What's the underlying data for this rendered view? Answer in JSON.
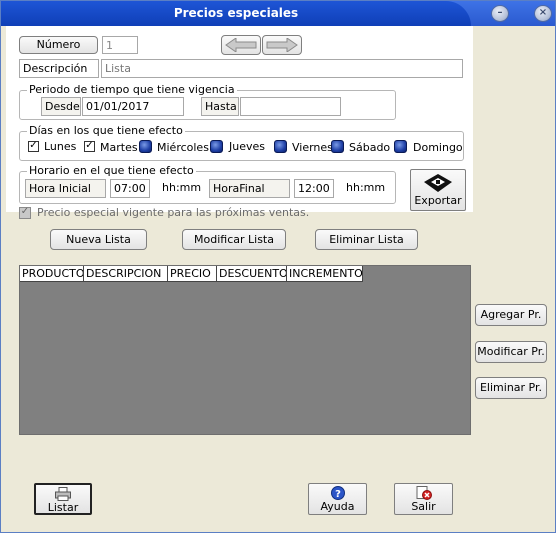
{
  "window": {
    "title": "Precios especiales",
    "minimize_glyph": "–",
    "close_glyph": "×"
  },
  "numero": {
    "button_label": "Número",
    "value": "1"
  },
  "descripcion": {
    "label": "Descripción",
    "value": "Lista"
  },
  "vigencia": {
    "legend": "Periodo de tiempo que tiene vigencia",
    "desde_label": "Desde",
    "desde_value": "01/01/2017",
    "hasta_label": "Hasta",
    "hasta_value": ""
  },
  "dias": {
    "legend": "Días en los que tiene efecto",
    "items": [
      {
        "label": "Lunes",
        "checked": true
      },
      {
        "label": "Martes",
        "checked": true
      },
      {
        "label": "Miércoles",
        "checked": false
      },
      {
        "label": "Jueves",
        "checked": false
      },
      {
        "label": "Viernes",
        "checked": false
      },
      {
        "label": "Sábado",
        "checked": false
      },
      {
        "label": "Domingo",
        "checked": false
      }
    ]
  },
  "horario": {
    "legend": "Horario en el que tiene efecto",
    "inicial_label": "Hora Inicial",
    "inicial_value": "07:00",
    "final_label": "HoraFinal",
    "final_value": "12:00",
    "unit": "hh:mm"
  },
  "exportar": {
    "label": "Exportar",
    "icon": "diskette-icon"
  },
  "vigente": {
    "label": "Precio especial vigente para las próximas ventas.",
    "checked": true
  },
  "lista_buttons": {
    "nueva": "Nueva Lista",
    "modificar": "Modificar Lista",
    "eliminar": "Eliminar Lista"
  },
  "table": {
    "columns": [
      "PRODUCTO",
      "DESCRIPCION",
      "PRECIO",
      "DESCUENTO",
      "INCREMENTO"
    ],
    "rows": []
  },
  "side_buttons": {
    "agregar": "Agregar Pr.",
    "modificar": "Modificar Pr.",
    "eliminar": "Eliminar Pr."
  },
  "bottom_buttons": {
    "listar": "Listar",
    "ayuda": "Ayuda",
    "salir": "Salir"
  }
}
